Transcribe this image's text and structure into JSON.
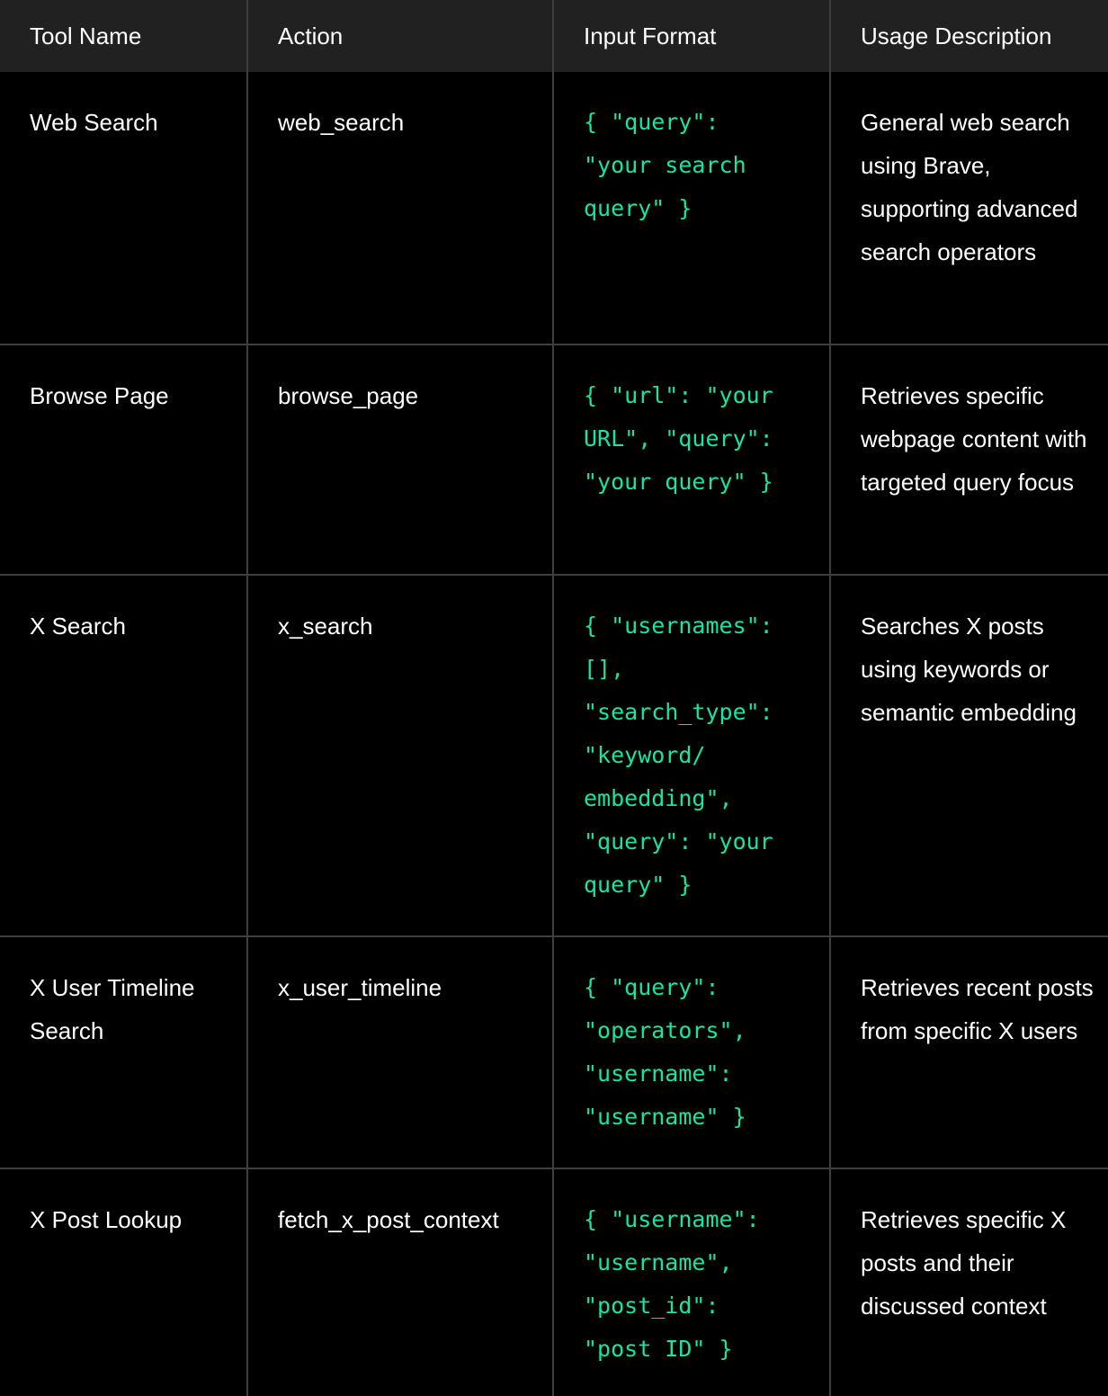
{
  "table": {
    "headers": [
      "Tool Name",
      "Action",
      "Input Format",
      "Usage Description"
    ],
    "accent_color": "#16e5a4",
    "rows": [
      {
        "tool_name": "Web Search",
        "action": "web_search",
        "input_format": "{ \"query\": \"your search query\" }",
        "input_lines": [
          "{ \"query\":",
          "\"your search",
          "query\" }"
        ],
        "description": "General web search using Brave, supporting advanced search operators"
      },
      {
        "tool_name": "Browse Page",
        "action": "browse_page",
        "input_format": "{ \"url\": \"your URL\", \"query\": \"your query\" }",
        "input_lines": [
          "{ \"url\": \"your",
          "URL\", \"query\":",
          "\"your query\" }"
        ],
        "description": "Retrieves specific webpage content with targeted query focus"
      },
      {
        "tool_name": "X Search",
        "action": "x_search",
        "input_format": "{ \"usernames\": [], \"search_type\": \"keyword/embedding\", \"query\": \"your query\" }",
        "input_lines": [
          "{ \"usernames\":",
          "[],",
          "\"search_type\":",
          "\"keyword/",
          "embedding\",",
          "\"query\": \"your",
          "query\" }"
        ],
        "description": "Searches X posts using keywords or semantic embedding"
      },
      {
        "tool_name": "X User Timeline Search",
        "action": "x_user_timeline",
        "input_format": "{ \"query\": \"operators\", \"username\": \"username\" }",
        "input_lines": [
          "{ \"query\":",
          "\"operators\",",
          "\"username\":",
          "\"username\" }"
        ],
        "description": "Retrieves recent posts from specific X users"
      },
      {
        "tool_name": "X Post Lookup",
        "action": "fetch_x_post_context",
        "input_format": "{ \"username\": \"username\", \"post_id\": \"post ID\" }",
        "input_lines": [
          "{ \"username\":",
          "\"username\",",
          "\"post_id\":",
          "\"post ID\" }"
        ],
        "description": "Retrieves specific X posts and their discussed context"
      }
    ]
  }
}
